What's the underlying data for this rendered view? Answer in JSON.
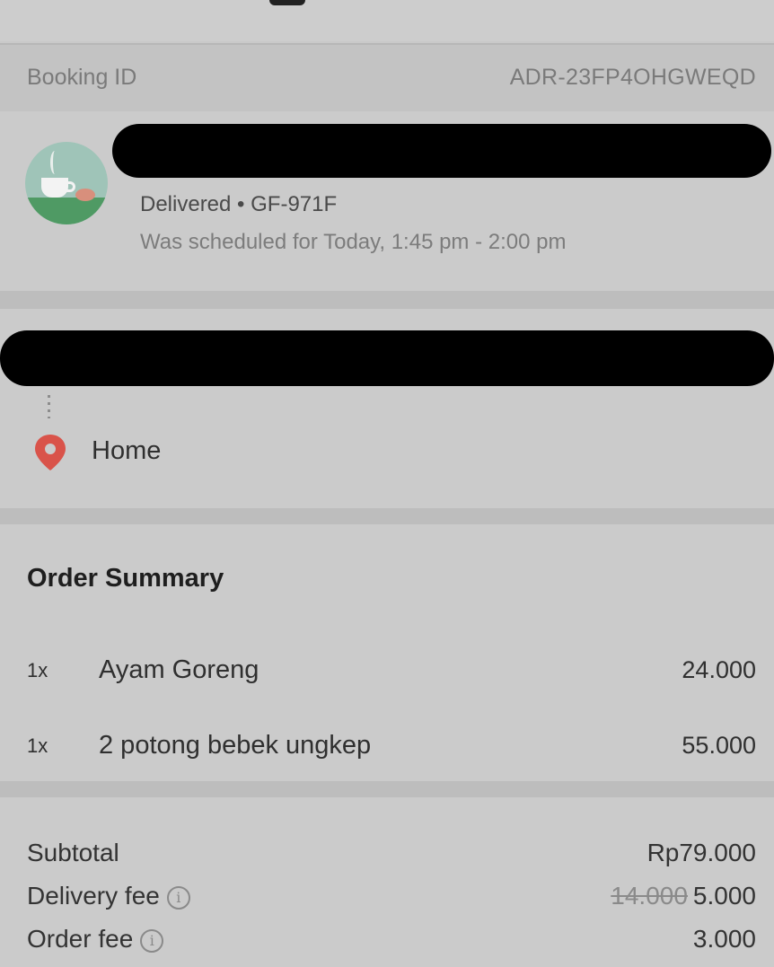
{
  "booking": {
    "label": "Booking ID",
    "value": "ADR-23FP4OHGWEQD"
  },
  "merchant": {
    "status": "Delivered • GF-971F",
    "schedule": "Was scheduled for Today, 1:45 pm - 2:00 pm"
  },
  "route": {
    "destination": "Home"
  },
  "order_summary": {
    "title": "Order Summary",
    "items": [
      {
        "qty": "1x",
        "name": "Ayam Goreng",
        "price": "24.000"
      },
      {
        "qty": "1x",
        "name": "2 potong bebek ungkep",
        "price": "55.000"
      }
    ]
  },
  "totals": {
    "subtotal": {
      "label": "Subtotal",
      "value": "Rp79.000"
    },
    "delivery_fee": {
      "label": "Delivery fee",
      "original": "14.000",
      "value": "5.000"
    },
    "order_fee": {
      "label": "Order fee",
      "value": "3.000"
    }
  },
  "icons": {
    "avatar": "merchant-logo-coffee-cup",
    "pickup": "pickup-dot-icon",
    "destination": "location-pin-icon",
    "info": "info-icon"
  },
  "colors": {
    "pin": "#d9534a",
    "pickup": "#2f86c7",
    "avatar_bg": "#9fc4b8"
  }
}
